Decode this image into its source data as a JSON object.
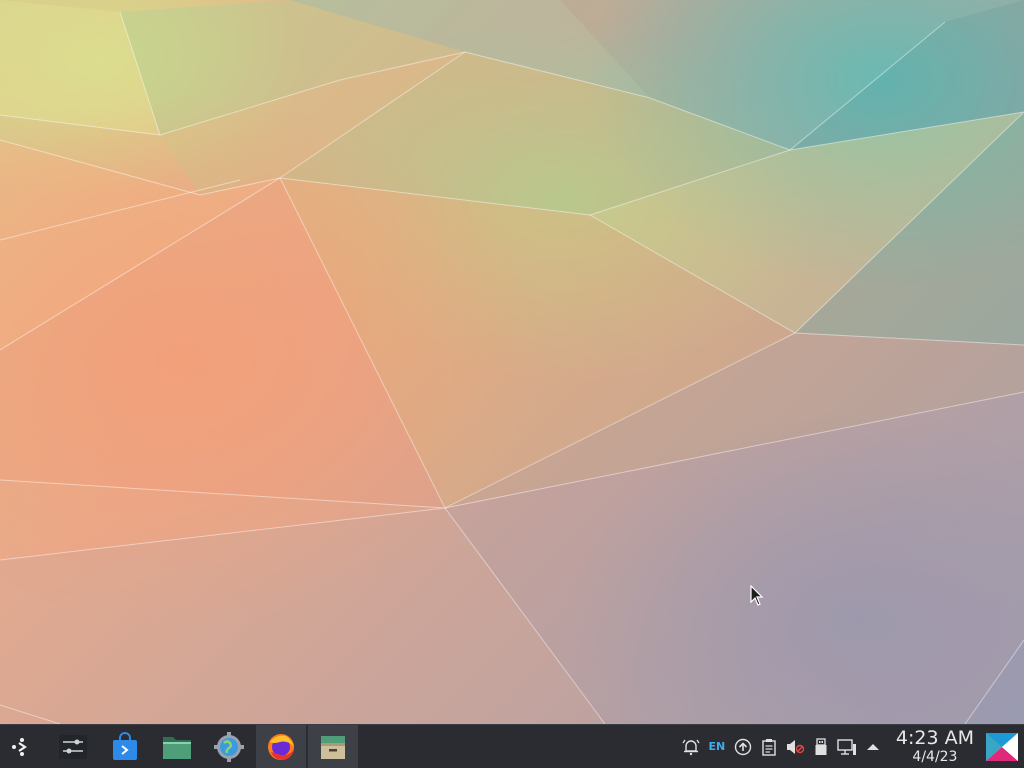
{
  "desktop": {
    "wallpaper": "polygonal gradient wallpaper",
    "colors": {
      "peach": "#eea584",
      "teal": "#6fbcb0",
      "lime": "#c6d18c",
      "mauve": "#a39eb4"
    }
  },
  "taskbar": {
    "background": "#2a2c31",
    "launcher_icon": "application-launcher-icon",
    "tasks": [
      {
        "name": "system-settings",
        "icon": "sliders-icon",
        "active": false
      },
      {
        "name": "discover",
        "icon": "store-bag-icon",
        "active": false
      },
      {
        "name": "dolphin",
        "icon": "folder-icon",
        "active": false
      },
      {
        "name": "web-settings",
        "icon": "gear-globe-icon",
        "active": false
      },
      {
        "name": "firefox",
        "icon": "firefox-icon",
        "active": true
      },
      {
        "name": "ark-archiver",
        "icon": "archive-box-icon",
        "active": true
      }
    ],
    "tray": {
      "language": "EN",
      "icons": [
        "notifications-icon",
        "language-indicator",
        "update-icon",
        "clipboard-icon",
        "volume-muted-icon",
        "usb-device-icon",
        "network-icon",
        "expand-arrow-icon"
      ]
    },
    "clock": {
      "time": "4:23 AM",
      "date": "4/4/23"
    }
  }
}
